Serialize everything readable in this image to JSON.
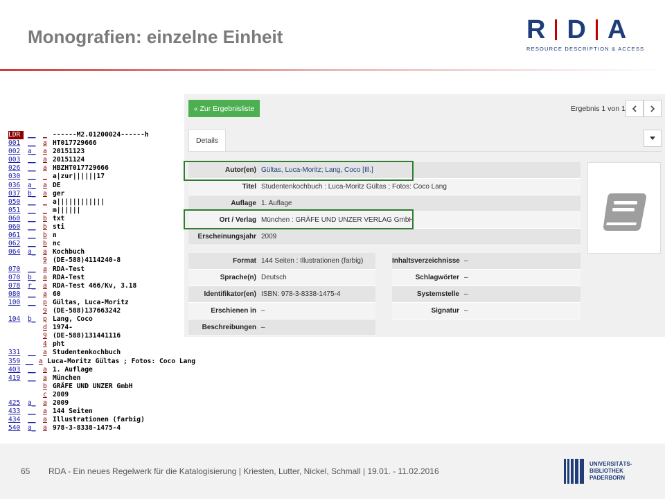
{
  "slide": {
    "title": "Monografien: einzelne Einheit",
    "page_number": "65",
    "footer_text": "RDA - Ein neues Regelwerk für die Katalogisierung | Kriesten, Lutter, Nickel, Schmall | 19.01. - 11.02.2016"
  },
  "rda_logo": {
    "letter_r": "R",
    "letter_d": "D",
    "letter_a": "A",
    "tagline": "RESOURCE DESCRIPTION & ACCESS"
  },
  "upb_logo": {
    "line1": "UNIVERSITÄTS-",
    "line2": "BIBLIOTHEK",
    "line3": "PADERBORN"
  },
  "marc": [
    {
      "tag": "LDR",
      "ind": "__",
      "sub": "_",
      "val": "------M2.01200024------h"
    },
    {
      "tag": "001",
      "ind": "__",
      "sub": "a",
      "val": "HT017729666"
    },
    {
      "tag": "002",
      "ind": "a_",
      "sub": "a",
      "val": "20151123"
    },
    {
      "tag": "003",
      "ind": "__",
      "sub": "a",
      "val": "20151124"
    },
    {
      "tag": "026",
      "ind": "__",
      "sub": "a",
      "val": "HBZHT017729666"
    },
    {
      "tag": "030",
      "ind": "__",
      "sub": "_",
      "val": "a|zur||||||17"
    },
    {
      "tag": "036",
      "ind": "a_",
      "sub": "a",
      "val": "DE"
    },
    {
      "tag": "037",
      "ind": "b_",
      "sub": "a",
      "val": "ger"
    },
    {
      "tag": "050",
      "ind": "__",
      "sub": "_",
      "val": "a||||||||||||"
    },
    {
      "tag": "051",
      "ind": "__",
      "sub": "_",
      "val": "m||||||"
    },
    {
      "tag": "060",
      "ind": "__",
      "sub": "b",
      "val": "txt"
    },
    {
      "tag": "060",
      "ind": "__",
      "sub": "b",
      "val": "sti"
    },
    {
      "tag": "061",
      "ind": "__",
      "sub": "b",
      "val": "n"
    },
    {
      "tag": "062",
      "ind": "__",
      "sub": "b",
      "val": "nc"
    },
    {
      "tag": "064",
      "ind": "a_",
      "sub": "a",
      "val": "Kochbuch"
    },
    {
      "tag": "",
      "ind": "",
      "sub": "9",
      "val": "(DE-588)4114240-8"
    },
    {
      "tag": "070",
      "ind": "__",
      "sub": "a",
      "val": "RDA-Test"
    },
    {
      "tag": "070",
      "ind": "b_",
      "sub": "a",
      "val": "RDA-Test"
    },
    {
      "tag": "078",
      "ind": "r_",
      "sub": "a",
      "val": "RDA-Test 466/Kv, 3.18"
    },
    {
      "tag": "080",
      "ind": "__",
      "sub": "a",
      "val": "60"
    },
    {
      "tag": "100",
      "ind": "__",
      "sub": "p",
      "val": "Gültas, Luca-Moritz"
    },
    {
      "tag": "",
      "ind": "",
      "sub": "9",
      "val": "(DE-588)137663242"
    },
    {
      "tag": "104",
      "ind": "b_",
      "sub": "p",
      "val": "Lang, Coco"
    },
    {
      "tag": "",
      "ind": "",
      "sub": "d",
      "val": "1974-"
    },
    {
      "tag": "",
      "ind": "",
      "sub": "9",
      "val": "(DE-588)131441116"
    },
    {
      "tag": "",
      "ind": "",
      "sub": "4",
      "val": "pht"
    },
    {
      "tag": "331",
      "ind": "__",
      "sub": "a",
      "val": "Studentenkochbuch"
    },
    {
      "tag": "359",
      "ind": "__",
      "sub": "a",
      "val": "Luca-Moritz Gültas ; Fotos: Coco Lang"
    },
    {
      "tag": "403",
      "ind": "__",
      "sub": "a",
      "val": "1. Auflage"
    },
    {
      "tag": "419",
      "ind": "__",
      "sub": "a",
      "val": "München"
    },
    {
      "tag": "",
      "ind": "",
      "sub": "b",
      "val": "GRÄFE UND UNZER GmbH"
    },
    {
      "tag": "",
      "ind": "",
      "sub": "c",
      "val": "2009"
    },
    {
      "tag": "425",
      "ind": "a_",
      "sub": "a",
      "val": "2009"
    },
    {
      "tag": "433",
      "ind": "__",
      "sub": "a",
      "val": "144 Seiten"
    },
    {
      "tag": "434",
      "ind": "__",
      "sub": "a",
      "val": "Illustrationen (farbig)"
    },
    {
      "tag": "540",
      "ind": "a_",
      "sub": "a",
      "val": "978-3-8338-1475-4"
    }
  ],
  "catalog": {
    "back_button": "« Zur Ergebnisliste",
    "result_count": "Ergebnis 1 von 1",
    "prev_icon": "chevron-left-icon",
    "next_icon": "chevron-right-icon",
    "tab_details": "Details",
    "details": [
      {
        "label": "Autor(en)",
        "value": "Gültas, Luca-Moritz; Lang, Coco [Ill.]"
      },
      {
        "label": "Titel",
        "value": "Studentenkochbuch : Luca-Moritz Gültas ; Fotos: Coco Lang"
      },
      {
        "label": "Auflage",
        "value": "1. Auflage"
      },
      {
        "label": "Ort / Verlag",
        "value": "München : GRÄFE UND UNZER VERLAG GmbH"
      },
      {
        "label": "Erscheinungsjahr",
        "value": "2009"
      }
    ],
    "grid_left": [
      {
        "label": "Format",
        "value": "144 Seiten : Illustrationen (farbig)"
      },
      {
        "label": "Sprache(n)",
        "value": "Deutsch"
      },
      {
        "label": "Identifikator(en)",
        "value": "ISBN: 978-3-8338-1475-4"
      },
      {
        "label": "Erschienen in",
        "value": "–"
      },
      {
        "label": "Beschreibungen",
        "value": "–"
      }
    ],
    "grid_right": [
      {
        "label": "Inhaltsverzeichnisse",
        "value": "–"
      },
      {
        "label": "Schlagwörter",
        "value": "–"
      },
      {
        "label": "Systemstelle",
        "value": "–"
      },
      {
        "label": "Signatur",
        "value": "–"
      }
    ],
    "thumbnail_icon": "book-icon",
    "highlight_color": "#2e7d32",
    "button_color": "#4caf50"
  }
}
